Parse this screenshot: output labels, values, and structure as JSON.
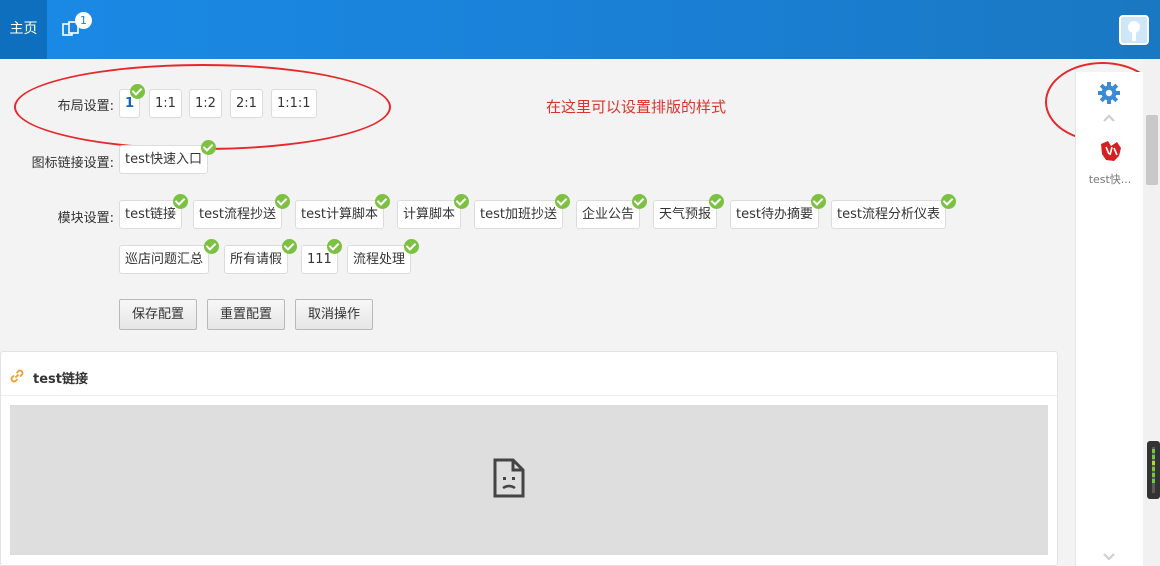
{
  "topbar": {
    "home_tab": "主页",
    "window_badge": "1"
  },
  "layout": {
    "label": "布局设置:",
    "options": [
      "1",
      "1:1",
      "1:2",
      "2:1",
      "1:1:1"
    ],
    "selected": "1"
  },
  "icon_links": {
    "label": "图标链接设置:",
    "items": [
      "test快速入口"
    ]
  },
  "modules": {
    "label": "模块设置:",
    "items": [
      "test链接",
      "test流程抄送",
      "test计算脚本",
      "计算脚本",
      "test加班抄送",
      "企业公告",
      "天气预报",
      "test待办摘要",
      "test流程分析仪表",
      "巡店问题汇总",
      "所有请假",
      "111",
      "流程处理"
    ]
  },
  "actions": {
    "save": "保存配置",
    "reset": "重置配置",
    "cancel": "取消操作"
  },
  "annotation": "在这里可以设置排版的样式",
  "panel": {
    "title": "test链接"
  },
  "rightbar": {
    "shortcut_label": "test快..."
  },
  "colors": {
    "topbar": "#1a7fd4",
    "check": "#7cc142",
    "annotation": "#d9342b"
  }
}
